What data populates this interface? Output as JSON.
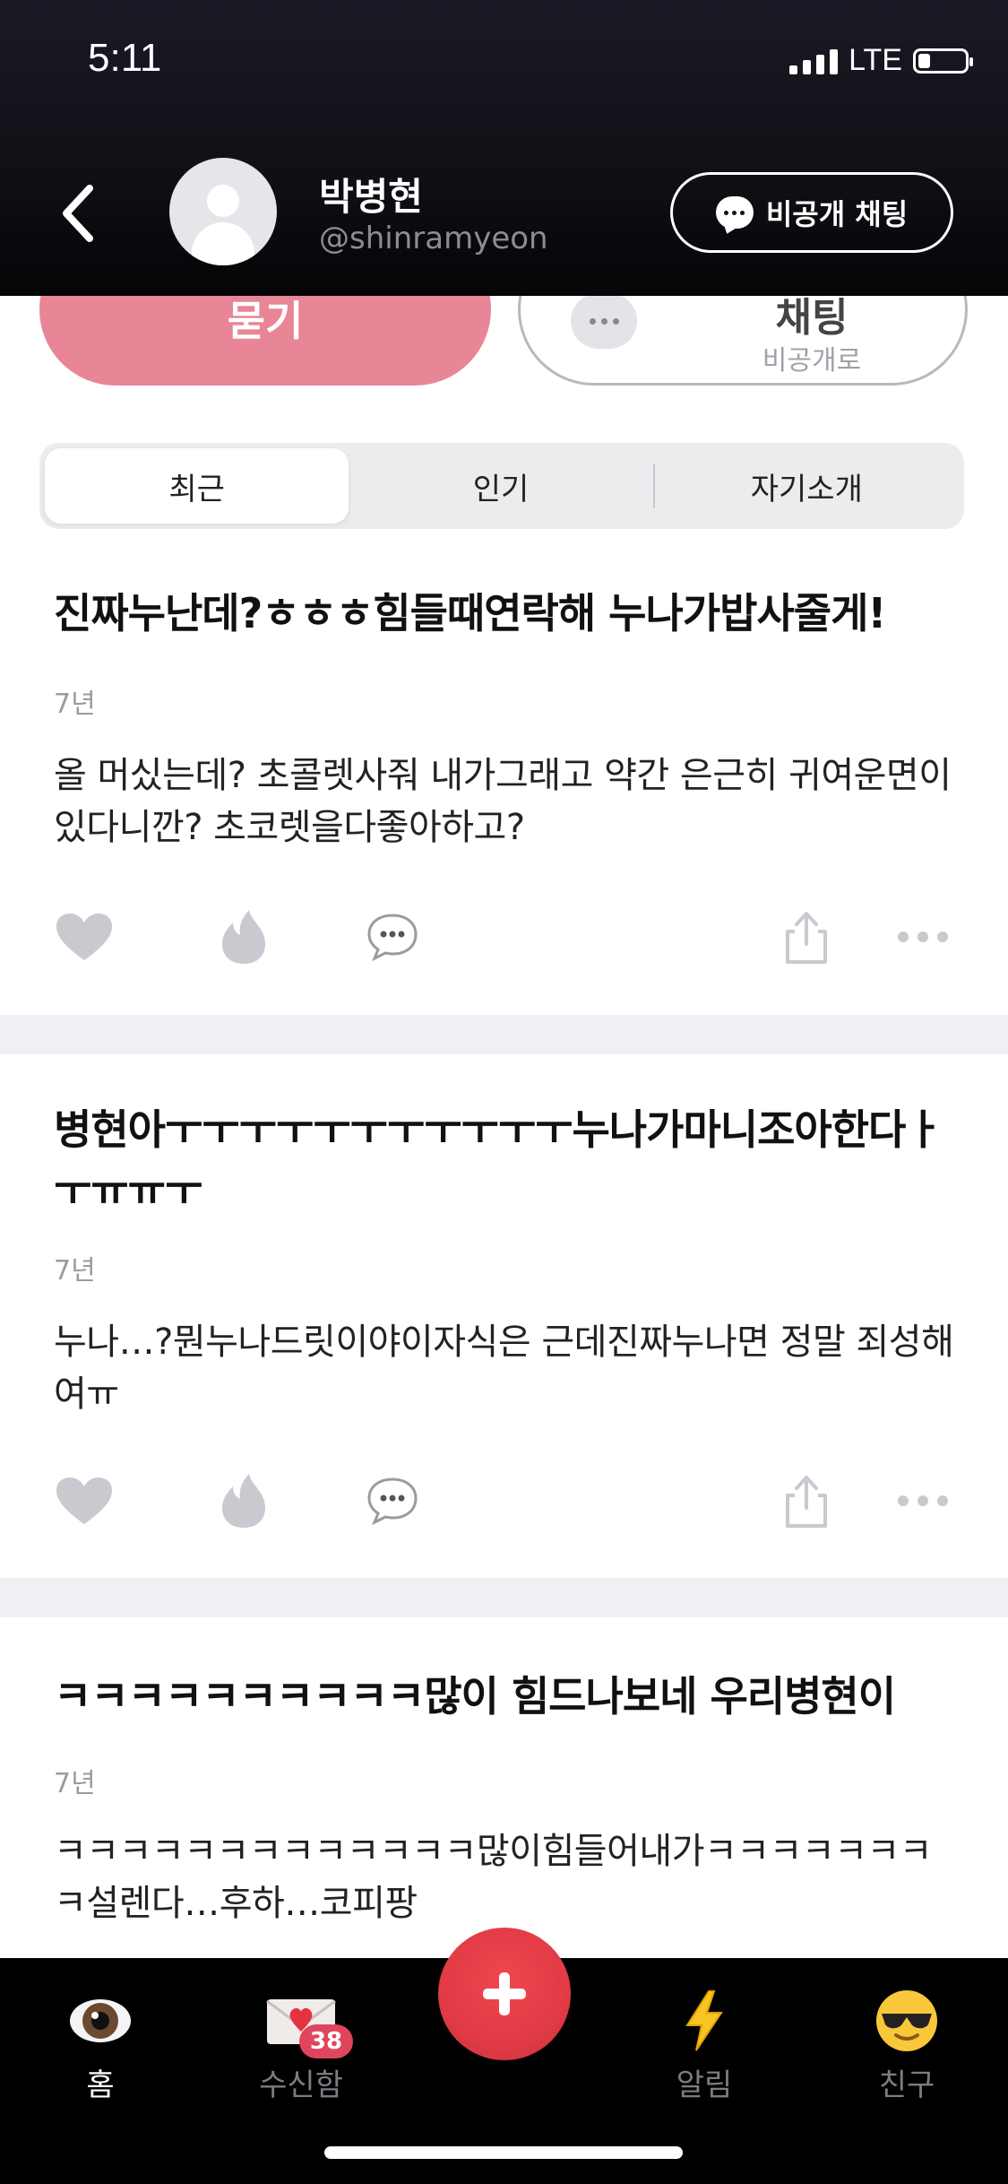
{
  "status_bar": {
    "time": "5:11",
    "network": "LTE",
    "battery_level": 0.25
  },
  "profile": {
    "name": "박병현",
    "handle": "@shinramyeon"
  },
  "header": {
    "private_chat_label": "비공개 채팅"
  },
  "actions_top": {
    "ask_label": "묻기",
    "chat_title": "채팅",
    "chat_subtitle": "비공개로"
  },
  "tabs": [
    {
      "label": "최근",
      "active": true
    },
    {
      "label": "인기",
      "active": false
    },
    {
      "label": "자기소개",
      "active": false
    }
  ],
  "posts": [
    {
      "title": "진짜누난데?ㅎㅎㅎ힘들때연락해 누나가밥사줄게!",
      "time": "7년",
      "body": "올 머싰는데? 초콜렛사줘 내가그래고 약간 은근히 귀여운면이있다니깐? 초코렛을다좋아하고?"
    },
    {
      "title": "병현아ㅜㅜㅜㅜㅜㅜㅜㅜㅜㅜㅜ누나가마니조아한다ㅏㅜㅠㅠㅜ",
      "time": "7년",
      "body": "누나…?뭔누나드릿이야이자식은 근데진짜누나면 정말 죄성해여ㅠ"
    },
    {
      "title": "ㅋㅋㅋㅋㅋㅋㅋㅋㅋㅋ많이 힘드나보네 우리병현이",
      "time": "7년",
      "body": "ㅋㅋㅋㅋㅋㅋㅋㅋㅋㅋㅋㅋㅋ많이힘들어내가ㅋㅋㅋㅋㅋㅋㅋㅋ설렌다…후하…코피팡"
    }
  ],
  "tabbar": {
    "items": [
      {
        "label": "홈",
        "icon": "eye-icon",
        "active": true
      },
      {
        "label": "수신함",
        "icon": "envelope-heart-icon",
        "badge": "38",
        "active": false
      },
      {
        "label": "알림",
        "icon": "lightning-icon",
        "active": false
      },
      {
        "label": "친구",
        "icon": "sunglasses-face-icon",
        "active": false
      }
    ],
    "fab_icon": "plus-icon"
  },
  "colors": {
    "accent_pink": "#e88597",
    "fab_red": "#e23b46",
    "badge_red": "#e0455e",
    "icon_gray": "#c9c9d0"
  }
}
